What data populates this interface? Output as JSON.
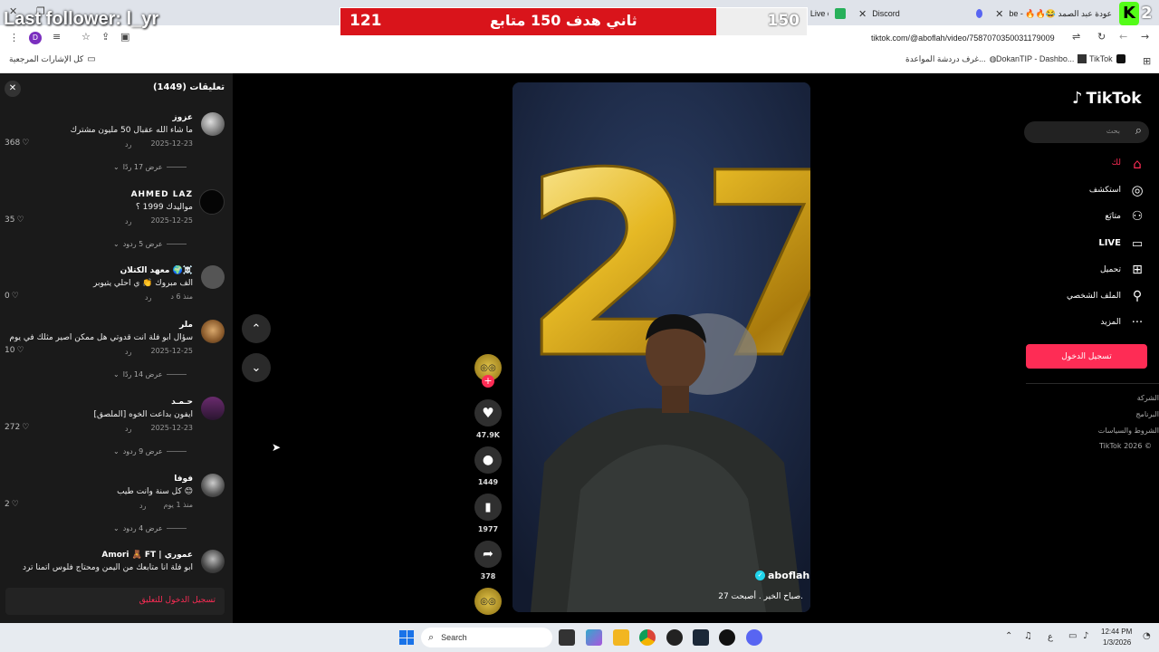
{
  "browser": {
    "tabs": [
      {
        "label": "R00X Stream - Watch Live on Kick"
      },
      {
        "label": "Discord"
      },
      {
        "label": "be - 🔥🔥😂 عودة عبد الصمد"
      }
    ],
    "url": "tiktok.com/@aboflah/video/7587070350031179009",
    "profile_initial": "D"
  },
  "bookmarks": {
    "all_bookmarks": "كل الإشارات المرجعية",
    "items": [
      {
        "label": "غرف دردشة المواعدة..."
      },
      {
        "label": "DokanTIP - Dashbo..."
      },
      {
        "label": "TikTok"
      }
    ]
  },
  "overlay": {
    "follower": "Last follower: l_yr",
    "goal_left": "121",
    "goal_text": "ثاني هدف 150 متابع",
    "goal_right": "150",
    "badge_number": "2",
    "colors": {
      "goal_red": "#d9141b",
      "badge_green": "#53fc18"
    }
  },
  "comments": {
    "header": "تعليقات (1449)",
    "reply_label": "رد",
    "items": [
      {
        "name": "عزوز",
        "text": "ما شاء الله عقبال 50 مليون مشترك",
        "date": "2025-12-23",
        "likes": "368",
        "view_replies": "عرض 17 ردًا"
      },
      {
        "name": "AHMED LAZ",
        "text": "مواليدك 1999 ؟",
        "date": "2025-12-25",
        "likes": "35",
        "view_replies": "عرض 5 ردود"
      },
      {
        "name": "معهد الكتلان 🌍☠️",
        "text": "الف مبروك 👏 ي احلي يتيوبر",
        "date": "منذ 6 د",
        "likes": "0",
        "view_replies": ""
      },
      {
        "name": "ملر",
        "text": "سؤال ابو فلة انت قدوتي هل ممكن اصير مثلك في يوم",
        "date": "2025-12-25",
        "likes": "10",
        "view_replies": "عرض 14 ردًا"
      },
      {
        "name": "حـمـد",
        "text": "ايفون بداعت الخوه [الملصق]",
        "date": "2025-12-23",
        "likes": "272",
        "view_replies": "عرض 9 ردود"
      },
      {
        "name": "فوفا",
        "text": "كل سنة وانت طيب 😊",
        "date": "منذ 1 يوم",
        "likes": "2",
        "view_replies": "عرض 4 ردود"
      },
      {
        "name": "Amori 🧸 FT | عموري",
        "text": "ابو فلة انا متابعك من اليمن ومحتاج فلوس اتمنا ترد",
        "date": "",
        "likes": "",
        "view_replies": ""
      }
    ],
    "login_to_comment": "تسجيل الدخول للتعليق"
  },
  "video": {
    "username": "aboflah",
    "caption": "صباح الخير . أصبحت 27.",
    "balloon_number": "27"
  },
  "actions": {
    "likes": "47.9K",
    "comments": "1449",
    "saves": "1977",
    "shares": "378"
  },
  "sidebar": {
    "logo": "TikTok",
    "search_placeholder": "بحث",
    "items": [
      {
        "label": "لك",
        "icon": "home-icon"
      },
      {
        "label": "استكشف",
        "icon": "compass-icon"
      },
      {
        "label": "متابَع",
        "icon": "following-icon"
      },
      {
        "label": "LIVE",
        "icon": "live-icon"
      },
      {
        "label": "تحميل",
        "icon": "upload-icon"
      },
      {
        "label": "الملف الشخصي",
        "icon": "profile-icon"
      },
      {
        "label": "المزيد",
        "icon": "more-icon"
      }
    ],
    "login_button": "تسجيل الدخول",
    "footer": [
      "الشركة",
      "البرنامج",
      "الشروط والسياسات",
      "TikTok 2026 ©"
    ],
    "accent": "#fe2c55"
  },
  "taskbar": {
    "search_label": "Search",
    "time": "12:44 PM",
    "date": "1/3/2026",
    "lang": "ع"
  }
}
